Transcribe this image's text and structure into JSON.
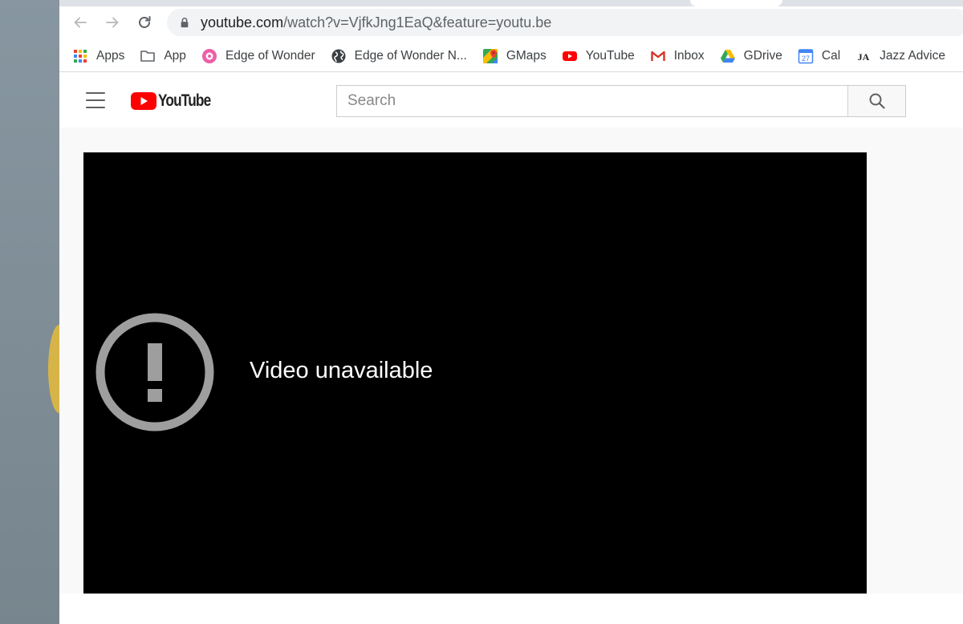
{
  "browser": {
    "url_host": "youtube.com",
    "url_path": "/watch?v=VjfkJng1EaQ&feature=youtu.be",
    "bookmarks": [
      {
        "label": "Apps",
        "icon": "apps-grid-icon"
      },
      {
        "label": "App",
        "icon": "folder-icon"
      },
      {
        "label": "Edge of Wonder",
        "icon": "edge-of-wonder-icon"
      },
      {
        "label": "Edge of Wonder N...",
        "icon": "globe-icon"
      },
      {
        "label": "GMaps",
        "icon": "google-maps-icon"
      },
      {
        "label": "YouTube",
        "icon": "youtube-icon"
      },
      {
        "label": "Inbox",
        "icon": "gmail-icon"
      },
      {
        "label": "GDrive",
        "icon": "google-drive-icon"
      },
      {
        "label": "Cal",
        "icon": "calendar-icon",
        "icon_text": "27"
      },
      {
        "label": "Jazz Advice",
        "icon": "jazz-advice-icon",
        "icon_text": "JA"
      }
    ]
  },
  "youtube": {
    "logo_text": "YouTube",
    "search_placeholder": "Search",
    "player": {
      "error_message": "Video unavailable"
    }
  },
  "colors": {
    "youtube_red": "#ff0000",
    "player_bg": "#000000",
    "error_icon": "#9e9e9e",
    "page_bg": "#f9f9f9"
  }
}
